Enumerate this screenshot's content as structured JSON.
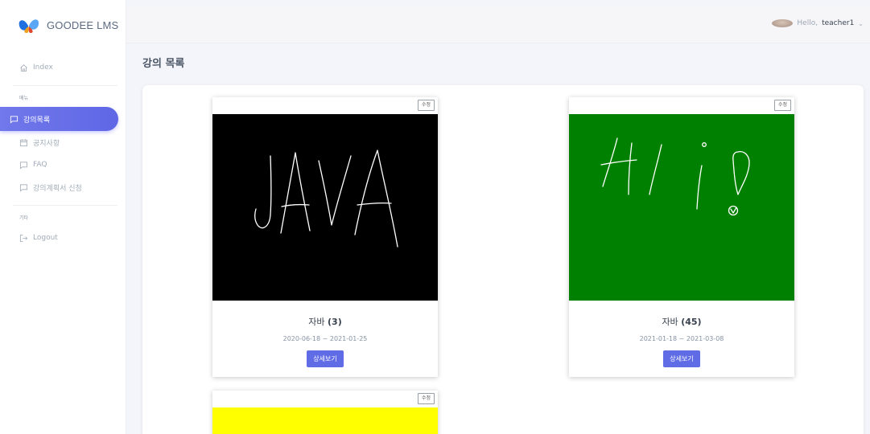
{
  "brand": {
    "name": "GOODEE LMS"
  },
  "sidebar": {
    "index_label": "Index",
    "menu_header": "메뉴",
    "items": [
      {
        "label": "강의목록",
        "icon": "chat-bubble-icon"
      },
      {
        "label": "공지사항",
        "icon": "calendar-icon"
      },
      {
        "label": "FAQ",
        "icon": "chat-bubble-icon"
      },
      {
        "label": "강의계획서 신청",
        "icon": "chat-bubble-icon"
      }
    ],
    "other_header": "기타",
    "logout_label": "Logout"
  },
  "header": {
    "greeting": "Hello,",
    "username": "teacher1"
  },
  "page": {
    "title": "강의 목록"
  },
  "courses": [
    {
      "edit_label": "수정",
      "title": "자바",
      "count": "(3)",
      "dates": "2020-06-18 ~ 2021-01-25",
      "detail_label": "상세보기",
      "thumb_bg": "#000000",
      "thumb_text": "JAVA"
    },
    {
      "edit_label": "수정",
      "title": "자바",
      "count": "(45)",
      "dates": "2021-01-18 ~ 2021-03-08",
      "detail_label": "상세보기",
      "thumb_bg": "#008000",
      "thumb_text": "Hi!"
    },
    {
      "edit_label": "수정",
      "thumb_bg": "#ffff00"
    }
  ],
  "colors": {
    "accent": "#696cff",
    "button": "#5f6ce6"
  }
}
